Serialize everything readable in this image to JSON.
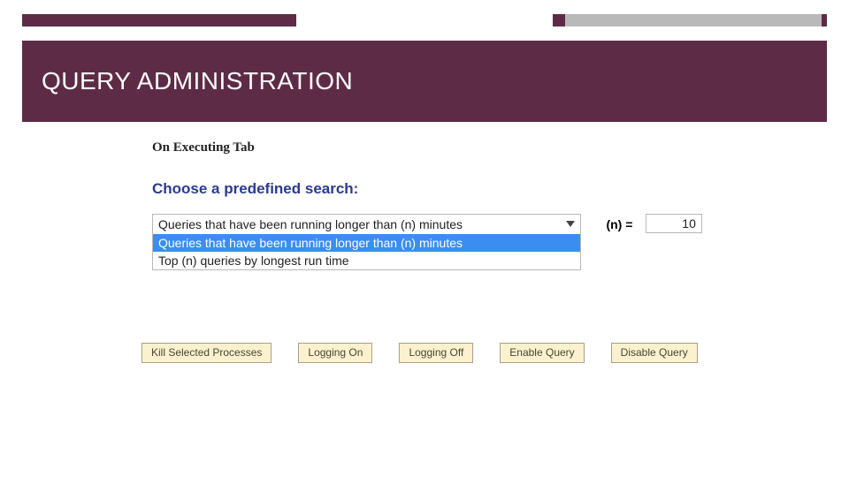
{
  "header": {
    "title": "QUERY ADMINISTRATION",
    "subtitle": "On Executing Tab"
  },
  "panel": {
    "heading": "Choose a predefined search:",
    "selected_option": "Queries that have been running longer than (n) minutes",
    "options": {
      "0": "Queries that have been running longer than (n) minutes",
      "1": "Top (n) queries by longest run time"
    },
    "n_label": "(n) =",
    "n_value": "10"
  },
  "actions": {
    "kill": "Kill Selected Processes",
    "logging_on": "Logging On",
    "logging_off": "Logging Off",
    "enable": "Enable Query",
    "disable": "Disable Query"
  }
}
